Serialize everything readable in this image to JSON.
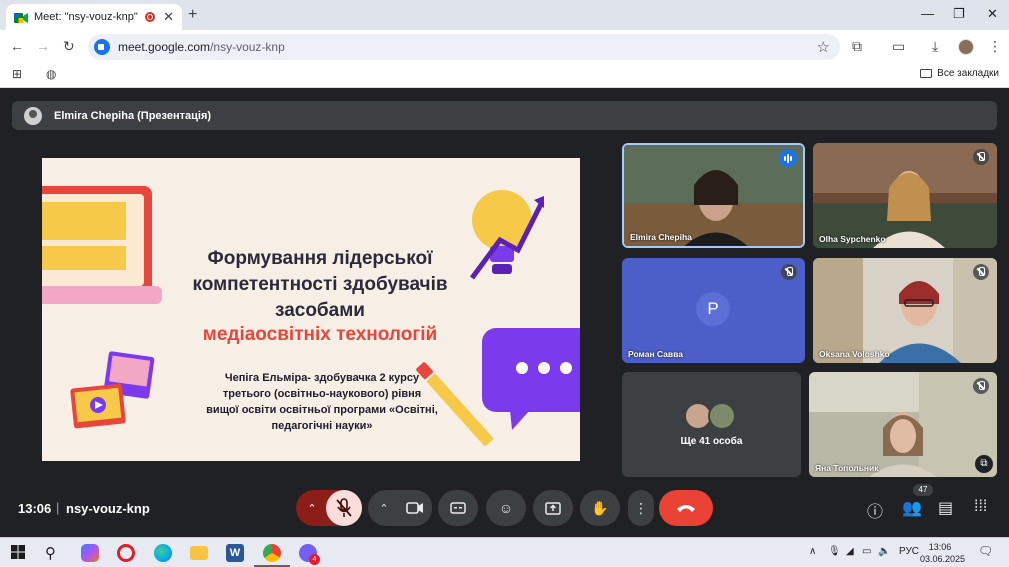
{
  "browser": {
    "tab_title": "Meet: \"nsy-vouz-knp\"",
    "url_host": "meet.google.com",
    "url_path": "/nsy-vouz-knp",
    "bookmarks_all": "Все закладки"
  },
  "presentation": {
    "presenter_label": "Elmira Chepiha (Презентація)"
  },
  "slide": {
    "title_line1": "Формування лідерської",
    "title_line2": "компетентності здобувачів",
    "title_line3": "засобами",
    "title_accent": "медіаосвітніх технологій",
    "subtitle_line1": "Чепіга Ельміра- здобувачка 2 курсу",
    "subtitle_line2": "третього (освітньо-наукового) рівня",
    "subtitle_line3": "вищої освіти освітньої програми «Освітні,",
    "subtitle_line4": "педагогічні науки»"
  },
  "participants": {
    "tile1_name": "Elmira Chepiha",
    "tile2_name": "Olha Sypchenko",
    "tile3_name": "Роман Савва",
    "tile3_initial": "P",
    "tile4_name": "Oksana Voloshko",
    "tile5_label": "Ще 41 особа",
    "tile6_name": "Яна Топольник"
  },
  "bottom": {
    "time": "13:06",
    "separator": "|",
    "meeting_code": "nsy-vouz-knp",
    "people_count": "47"
  },
  "taskbar": {
    "language": "РУС",
    "clock_time": "13:06",
    "clock_date": "03.06.2025",
    "viber_badge": "4"
  },
  "colors": {
    "meet_bg": "#202124",
    "tile_bg": "#3c4043",
    "end_call": "#ea4335",
    "mic_off_bg": "#f9dedc",
    "accent_blue": "#1a73e8",
    "slide_accent": "#e8453c"
  }
}
